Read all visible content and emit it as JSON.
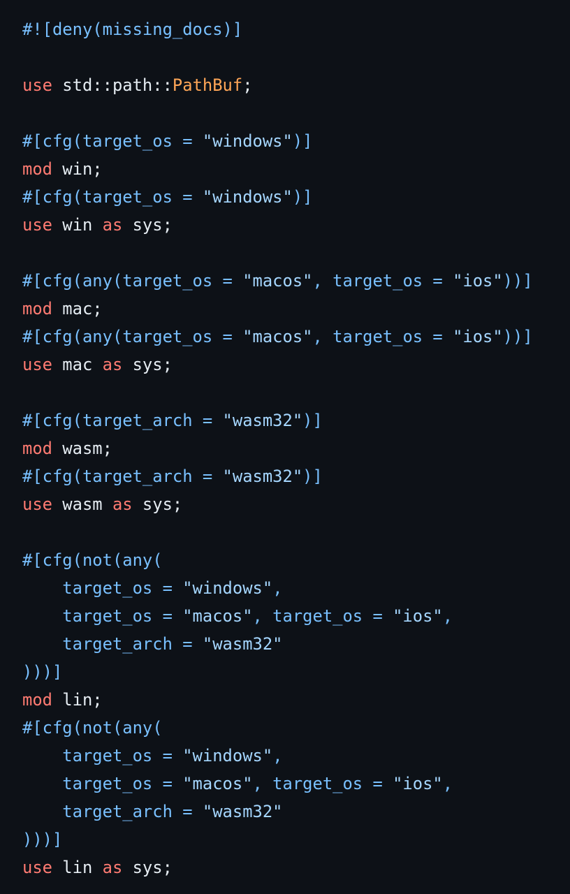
{
  "colors": {
    "background": "#0d1117",
    "attribute": "#79c0ff",
    "string": "#a5d6ff",
    "keyword": "#ff7b72",
    "type": "#ffa657",
    "text": "#e6edf3"
  },
  "code_lines": [
    [
      [
        "#![deny(missing_docs)]",
        "attr"
      ]
    ],
    [],
    [
      [
        "use",
        "kw"
      ],
      [
        " std::path::",
        "plain"
      ],
      [
        "PathBuf",
        "type"
      ],
      [
        ";",
        "plain"
      ]
    ],
    [],
    [
      [
        "#[cfg(target_os = ",
        "attr"
      ],
      [
        "\"windows\"",
        "str"
      ],
      [
        ")]",
        "attr"
      ]
    ],
    [
      [
        "mod",
        "kw"
      ],
      [
        " win;",
        "plain"
      ]
    ],
    [
      [
        "#[cfg(target_os = ",
        "attr"
      ],
      [
        "\"windows\"",
        "str"
      ],
      [
        ")]",
        "attr"
      ]
    ],
    [
      [
        "use",
        "kw"
      ],
      [
        " win ",
        "plain"
      ],
      [
        "as",
        "kw"
      ],
      [
        " sys;",
        "plain"
      ]
    ],
    [],
    [
      [
        "#[cfg(any(target_os = ",
        "attr"
      ],
      [
        "\"macos\"",
        "str"
      ],
      [
        ", target_os = ",
        "attr"
      ],
      [
        "\"ios\"",
        "str"
      ],
      [
        "))]",
        "attr"
      ]
    ],
    [
      [
        "mod",
        "kw"
      ],
      [
        " mac;",
        "plain"
      ]
    ],
    [
      [
        "#[cfg(any(target_os = ",
        "attr"
      ],
      [
        "\"macos\"",
        "str"
      ],
      [
        ", target_os = ",
        "attr"
      ],
      [
        "\"ios\"",
        "str"
      ],
      [
        "))]",
        "attr"
      ]
    ],
    [
      [
        "use",
        "kw"
      ],
      [
        " mac ",
        "plain"
      ],
      [
        "as",
        "kw"
      ],
      [
        " sys;",
        "plain"
      ]
    ],
    [],
    [
      [
        "#[cfg(target_arch = ",
        "attr"
      ],
      [
        "\"wasm32\"",
        "str"
      ],
      [
        ")]",
        "attr"
      ]
    ],
    [
      [
        "mod",
        "kw"
      ],
      [
        " wasm;",
        "plain"
      ]
    ],
    [
      [
        "#[cfg(target_arch = ",
        "attr"
      ],
      [
        "\"wasm32\"",
        "str"
      ],
      [
        ")]",
        "attr"
      ]
    ],
    [
      [
        "use",
        "kw"
      ],
      [
        " wasm ",
        "plain"
      ],
      [
        "as",
        "kw"
      ],
      [
        " sys;",
        "plain"
      ]
    ],
    [],
    [
      [
        "#[cfg(not(any(",
        "attr"
      ]
    ],
    [
      [
        "    target_os = ",
        "attr"
      ],
      [
        "\"windows\"",
        "str"
      ],
      [
        ",",
        "attr"
      ]
    ],
    [
      [
        "    target_os = ",
        "attr"
      ],
      [
        "\"macos\"",
        "str"
      ],
      [
        ", target_os = ",
        "attr"
      ],
      [
        "\"ios\"",
        "str"
      ],
      [
        ",",
        "attr"
      ]
    ],
    [
      [
        "    target_arch = ",
        "attr"
      ],
      [
        "\"wasm32\"",
        "str"
      ]
    ],
    [
      [
        ")))]",
        "attr"
      ]
    ],
    [
      [
        "mod",
        "kw"
      ],
      [
        " lin;",
        "plain"
      ]
    ],
    [
      [
        "#[cfg(not(any(",
        "attr"
      ]
    ],
    [
      [
        "    target_os = ",
        "attr"
      ],
      [
        "\"windows\"",
        "str"
      ],
      [
        ",",
        "attr"
      ]
    ],
    [
      [
        "    target_os = ",
        "attr"
      ],
      [
        "\"macos\"",
        "str"
      ],
      [
        ", target_os = ",
        "attr"
      ],
      [
        "\"ios\"",
        "str"
      ],
      [
        ",",
        "attr"
      ]
    ],
    [
      [
        "    target_arch = ",
        "attr"
      ],
      [
        "\"wasm32\"",
        "str"
      ]
    ],
    [
      [
        ")))]",
        "attr"
      ]
    ],
    [
      [
        "use",
        "kw"
      ],
      [
        " lin ",
        "plain"
      ],
      [
        "as",
        "kw"
      ],
      [
        " sys;",
        "plain"
      ]
    ]
  ]
}
